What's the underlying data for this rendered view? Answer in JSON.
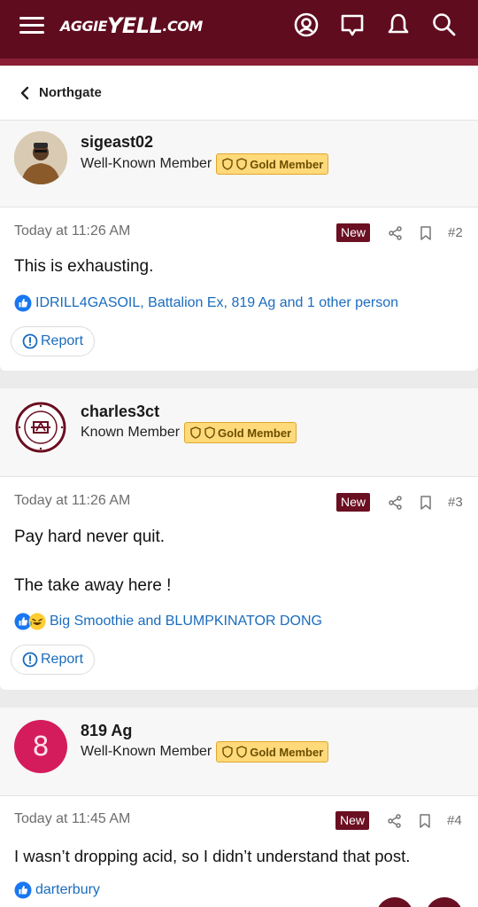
{
  "header": {
    "logo_part1": "AGGIE",
    "logo_part2": "YELL",
    "logo_part3": ".COM",
    "icons": [
      "menu-icon",
      "account-icon",
      "messages-icon",
      "alerts-icon",
      "search-icon"
    ]
  },
  "breadcrumb": {
    "label": "Northgate",
    "icon": "chevron-left-icon"
  },
  "posts": [
    {
      "username": "sigeast02",
      "user_title": "Well-Known Member",
      "badge": "Gold Member",
      "timestamp": "Today at 11:26 AM",
      "new_label": "New",
      "post_number": "#2",
      "body": [
        "This is exhausting."
      ],
      "reactions": "IDRILL4GASOIL, Battalion Ex, 819 Ag and 1 other person",
      "reaction_icons": [
        "like-icon"
      ],
      "report_label": "Report"
    },
    {
      "username": "charles3ct",
      "user_title": "Known Member",
      "badge": "Gold Member",
      "timestamp": "Today at 11:26 AM",
      "new_label": "New",
      "post_number": "#3",
      "body": [
        "Pay hard never quit.",
        "The take away here !"
      ],
      "reactions": "Big Smoothie and BLUMPKINATOR DONG",
      "reaction_icons": [
        "like-icon",
        "laugh-icon"
      ],
      "report_label": "Report"
    },
    {
      "username": "819 Ag",
      "avatar_letter": "8",
      "user_title": "Well-Known Member",
      "badge": "Gold Member",
      "timestamp": "Today at 11:45 AM",
      "new_label": "New",
      "post_number": "#4",
      "body": [
        "I wasn’t dropping acid, so I didn’t understand that post."
      ],
      "reactions": "darterbury",
      "reaction_icons": [
        "like-icon"
      ]
    }
  ],
  "colors": {
    "brand": "#5f0c1f",
    "link": "#1a6cbd",
    "gold": "#ffd97a",
    "avatar_pink": "#d41c5c"
  }
}
